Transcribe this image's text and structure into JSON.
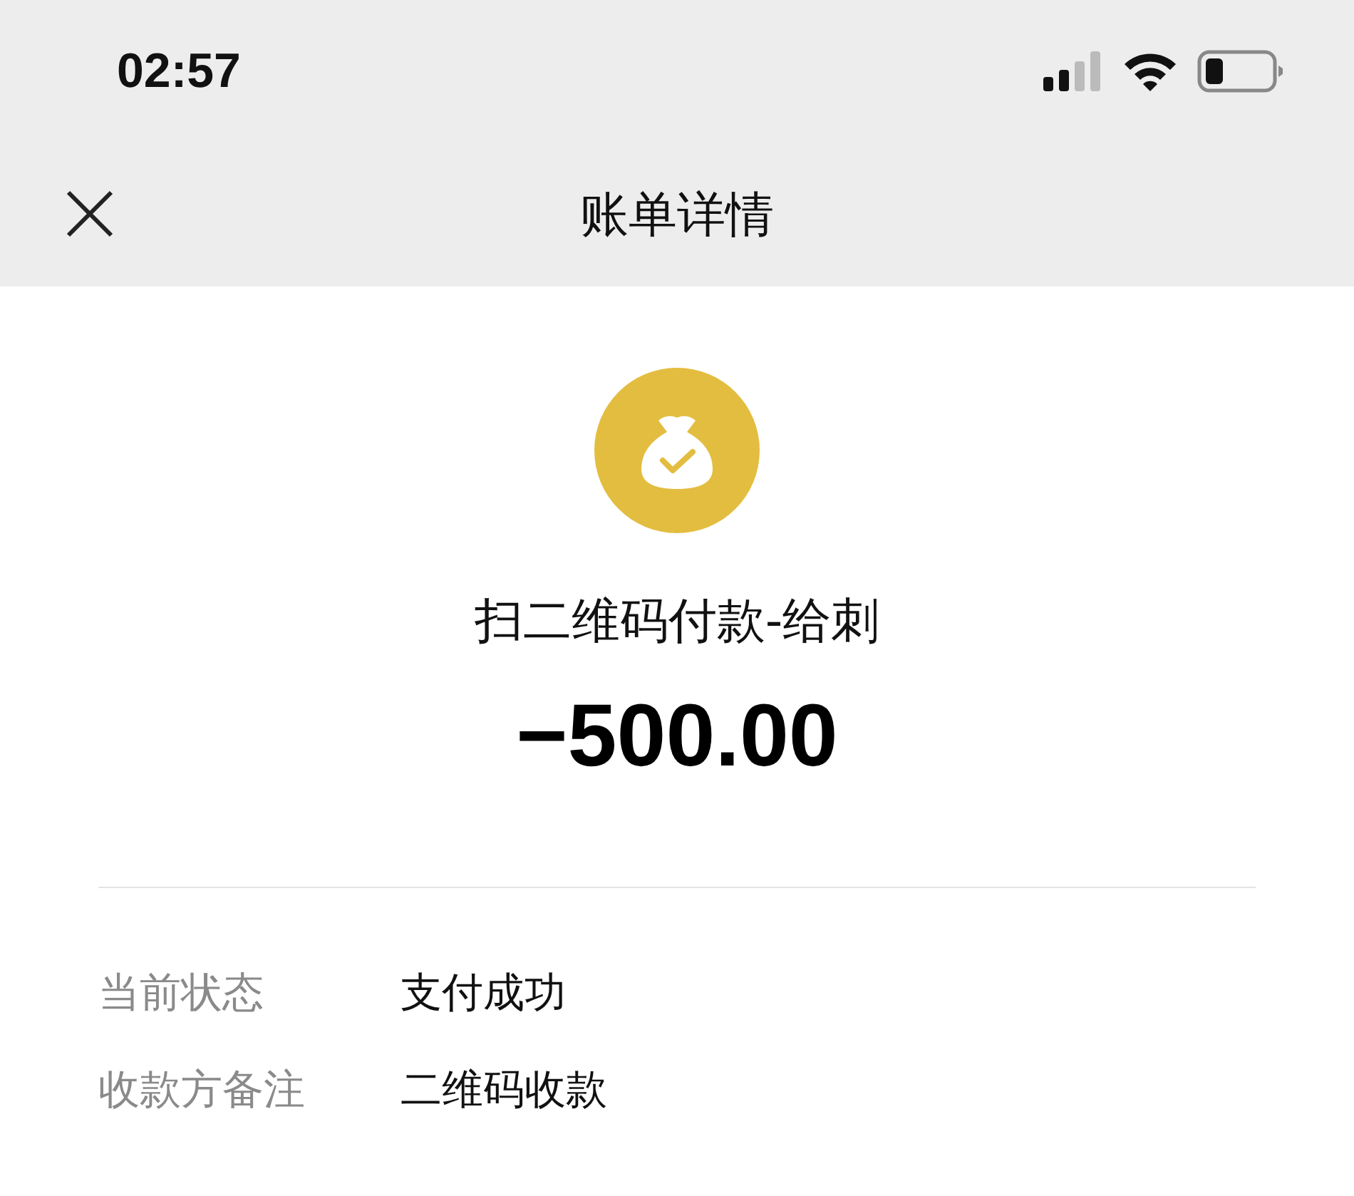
{
  "status_bar": {
    "time": "02:57"
  },
  "nav_bar": {
    "title": "账单详情"
  },
  "bill": {
    "title": "扫二维码付款-给刺",
    "amount": "−500.00"
  },
  "details": [
    {
      "label": "当前状态",
      "value": "支付成功"
    },
    {
      "label": "收款方备注",
      "value": "二维码收款"
    }
  ]
}
